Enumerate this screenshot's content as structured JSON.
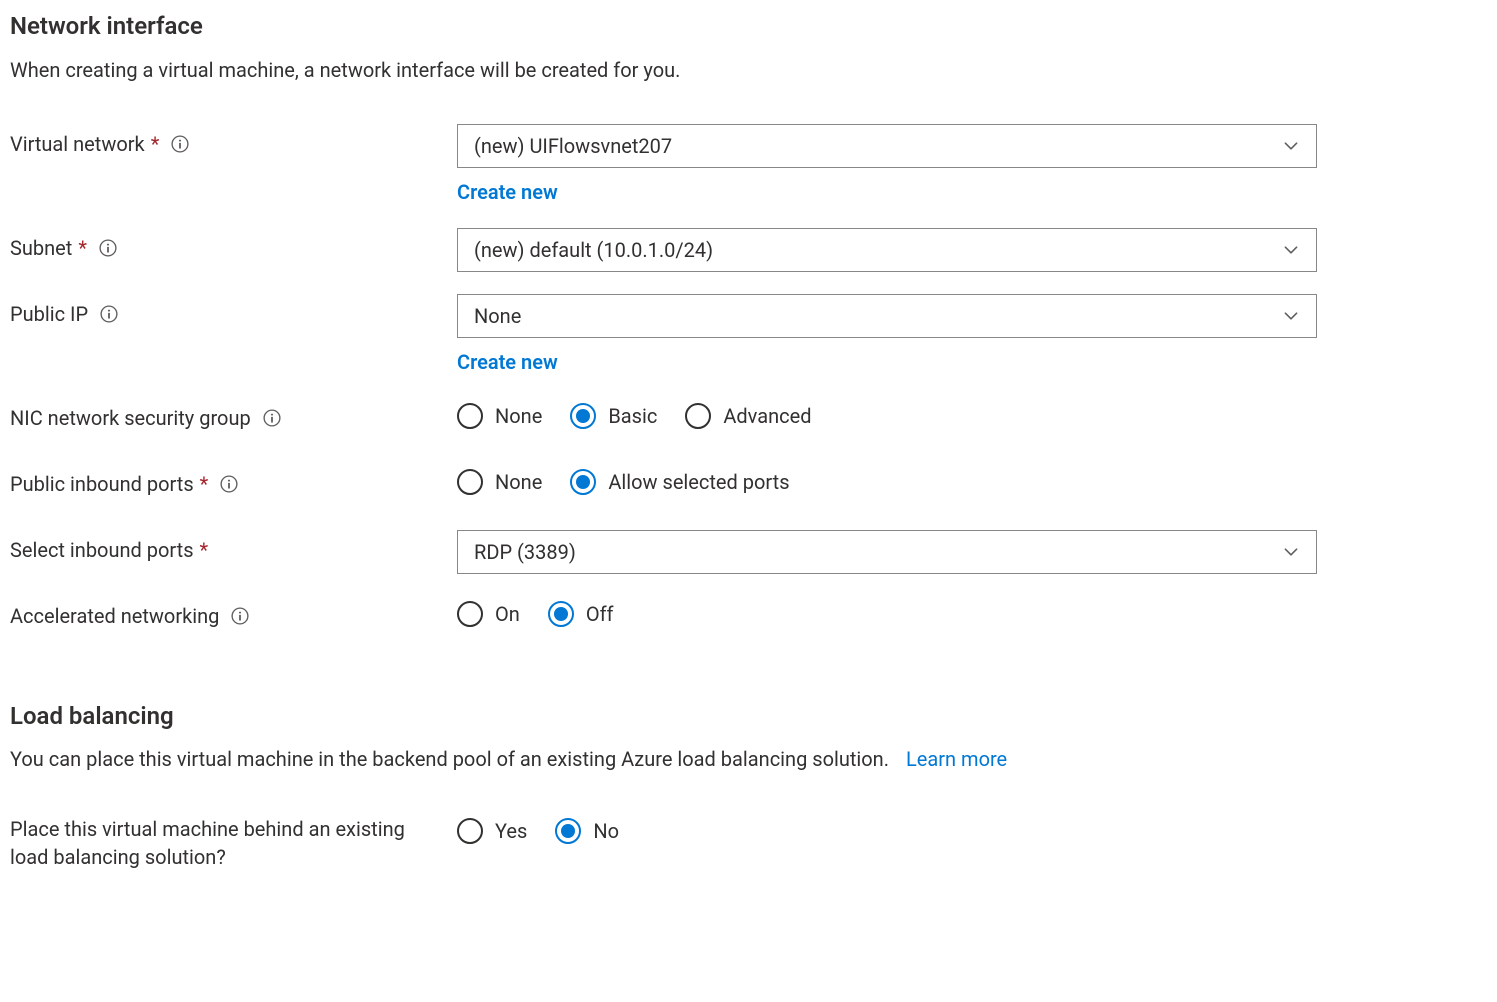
{
  "networkInterface": {
    "title": "Network interface",
    "description": "When creating a virtual machine, a network interface will be created for you.",
    "virtualNetwork": {
      "label": "Virtual network",
      "value": "(new) UIFlowsvnet207",
      "createNew": "Create new"
    },
    "subnet": {
      "label": "Subnet",
      "value": "(new) default (10.0.1.0/24)"
    },
    "publicIp": {
      "label": "Public IP",
      "value": "None",
      "createNew": "Create new"
    },
    "nsg": {
      "label": "NIC network security group",
      "options": {
        "none": "None",
        "basic": "Basic",
        "advanced": "Advanced"
      },
      "selected": "basic"
    },
    "publicInboundPorts": {
      "label": "Public inbound ports",
      "options": {
        "none": "None",
        "allow": "Allow selected ports"
      },
      "selected": "allow"
    },
    "selectInboundPorts": {
      "label": "Select inbound ports",
      "value": "RDP (3389)"
    },
    "acceleratedNetworking": {
      "label": "Accelerated networking",
      "options": {
        "on": "On",
        "off": "Off"
      },
      "selected": "off"
    }
  },
  "loadBalancing": {
    "title": "Load balancing",
    "description": "You can place this virtual machine in the backend pool of an existing Azure load balancing solution.",
    "learnMore": "Learn more",
    "placeBehind": {
      "label": "Place this virtual machine behind an existing load balancing solution?",
      "options": {
        "yes": "Yes",
        "no": "No"
      },
      "selected": "no"
    }
  }
}
